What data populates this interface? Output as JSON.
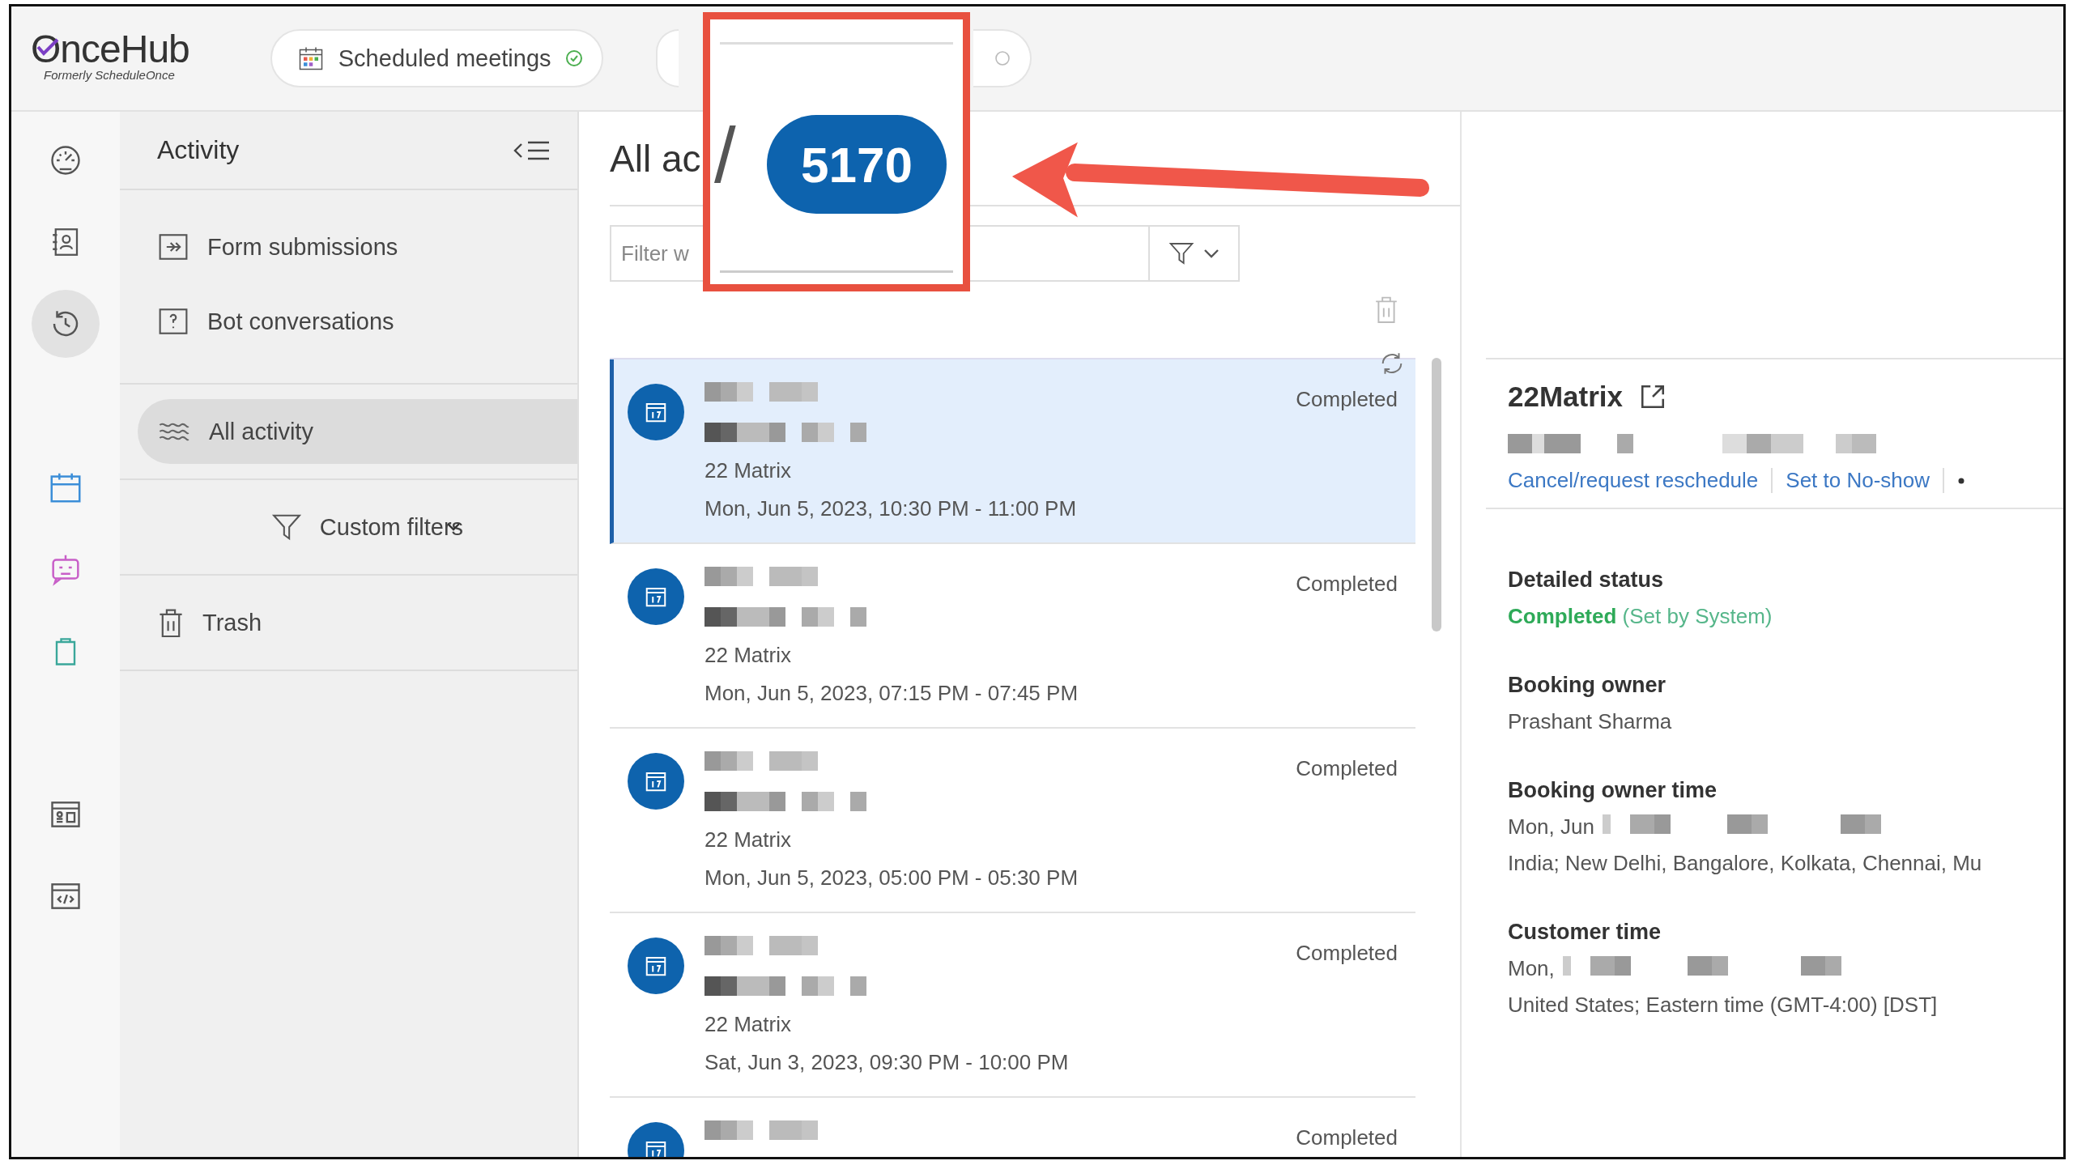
{
  "app": {
    "logo": "OnceHub",
    "logo_subtitle": "Formerly ScheduleOnce"
  },
  "top_tabs": [
    {
      "label": "Scheduled meetings",
      "kind": "calendar"
    },
    {
      "kind": "covered"
    }
  ],
  "rail_groups": [
    {
      "items": [
        {
          "kind": "dashboard",
          "selected": false
        },
        {
          "kind": "contacts",
          "selected": false
        },
        {
          "kind": "history",
          "selected": true
        }
      ]
    },
    {
      "items": [
        {
          "kind": "calendar",
          "selected": false
        },
        {
          "kind": "bot",
          "selected": false
        },
        {
          "kind": "clipboard",
          "selected": false
        }
      ]
    },
    {
      "items": [
        {
          "kind": "profile",
          "selected": false
        },
        {
          "kind": "code",
          "selected": false
        }
      ]
    }
  ],
  "sidebar": {
    "title": "Activity",
    "groups": [
      {
        "items": [
          {
            "label": "Form submissions",
            "kind": "form",
            "selected": false
          },
          {
            "label": "Bot conversations",
            "kind": "bot",
            "selected": false
          }
        ]
      },
      {
        "items": [
          {
            "label": "All activity",
            "kind": "activity",
            "selected": true
          }
        ]
      },
      {
        "items": [
          {
            "label": "Custom filters",
            "kind": "filter",
            "selected": false
          }
        ]
      },
      {
        "items": [
          {
            "label": "Trash",
            "kind": "trash",
            "selected": false
          }
        ]
      }
    ]
  },
  "main": {
    "title": "All ac",
    "filter": {
      "placeholder": "Filter w"
    },
    "rows": [
      {
        "name_redacted": true,
        "detail_redacted": true,
        "event": "22 Matrix",
        "time": "Mon, Jun 5, 2023, 10:30 PM - 11:00 PM",
        "status": "Completed",
        "selected": true
      },
      {
        "name_redacted": true,
        "detail_redacted": true,
        "event": "22 Matrix",
        "time": "Mon, Jun 5, 2023, 07:15 PM - 07:45 PM",
        "status": "Completed",
        "selected": false
      },
      {
        "name_redacted": true,
        "detail_redacted": true,
        "event": "22 Matrix",
        "time": "Mon, Jun 5, 2023, 05:00 PM - 05:30 PM",
        "status": "Completed",
        "selected": false
      },
      {
        "name_redacted": true,
        "detail_redacted": true,
        "event": "22 Matrix",
        "time": "Sat, Jun 3, 2023, 09:30 PM - 10:00 PM",
        "status": "Completed",
        "selected": false
      },
      {
        "name_redacted": true,
        "detail_redacted": false,
        "status": "Completed",
        "selected": false
      }
    ]
  },
  "detail": {
    "title": "22Matrix",
    "subtitle_redacted": true,
    "actions": [
      "Cancel/request reschedule",
      "Set to No-show"
    ],
    "sections": [
      {
        "heading": "Detailed status",
        "lines": [
          {
            "text": "**Completed** (Set by System)",
            "kind": "status",
            "redacted": false
          }
        ]
      },
      {
        "heading": "Booking owner",
        "lines": [
          {
            "text": "Prashant Sharma",
            "kind": "plain",
            "redacted": false
          }
        ]
      },
      {
        "heading": "Booking owner time",
        "lines": [
          {
            "text": "Mon, Jun",
            "kind": "plain",
            "redacted": true
          },
          {
            "text": "India; New Delhi, Bangalore, Kolkata, Chennai, Mu",
            "kind": "plain",
            "redacted": false
          }
        ]
      },
      {
        "heading": "Customer time",
        "lines": [
          {
            "text": "Mon,",
            "kind": "plain",
            "redacted": true
          },
          {
            "text": "United States; Eastern time (GMT-4:00) [DST]",
            "kind": "plain",
            "redacted": false
          }
        ]
      }
    ]
  },
  "annotation": {
    "badge": "5170",
    "fragment": "/"
  }
}
